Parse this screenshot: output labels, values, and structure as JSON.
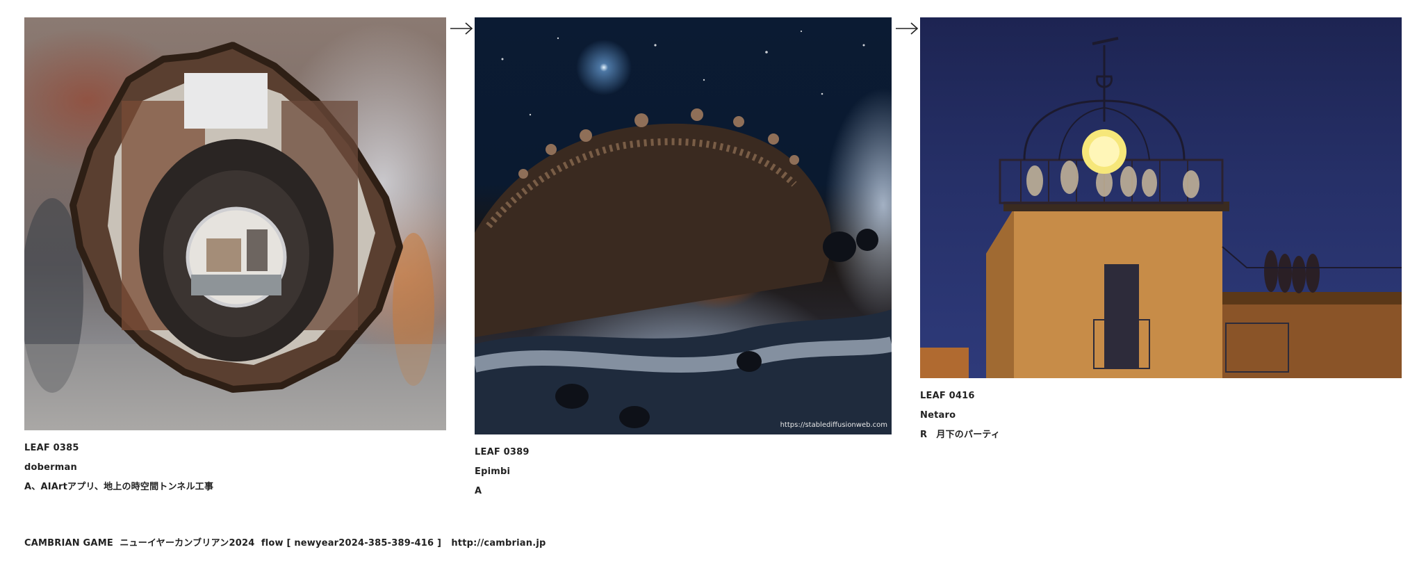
{
  "leaves": [
    {
      "number": "LEAF 0385",
      "author": "doberman",
      "caption": "A、AIArtアプリ、地上の時空間トンネル工事",
      "image_icon": "tunnel-hole-image"
    },
    {
      "number": "LEAF 0389",
      "author": "Epimbi",
      "caption": "A",
      "image_icon": "cosmic-cave-image",
      "image_credit": "https://stablediffusionweb.com"
    },
    {
      "number": "LEAF 0416",
      "author": "Netaro",
      "caption": "R　月下のパーティ",
      "image_icon": "night-rooftop-party-image"
    }
  ],
  "arrows": [
    "arrow-right-icon",
    "arrow-right-icon"
  ],
  "footer": {
    "text": "CAMBRIAN GAME  ニューイヤーカンブリアン2024  flow [ newyear2024-385-389-416 ]",
    "url": "http://cambrian.jp"
  }
}
